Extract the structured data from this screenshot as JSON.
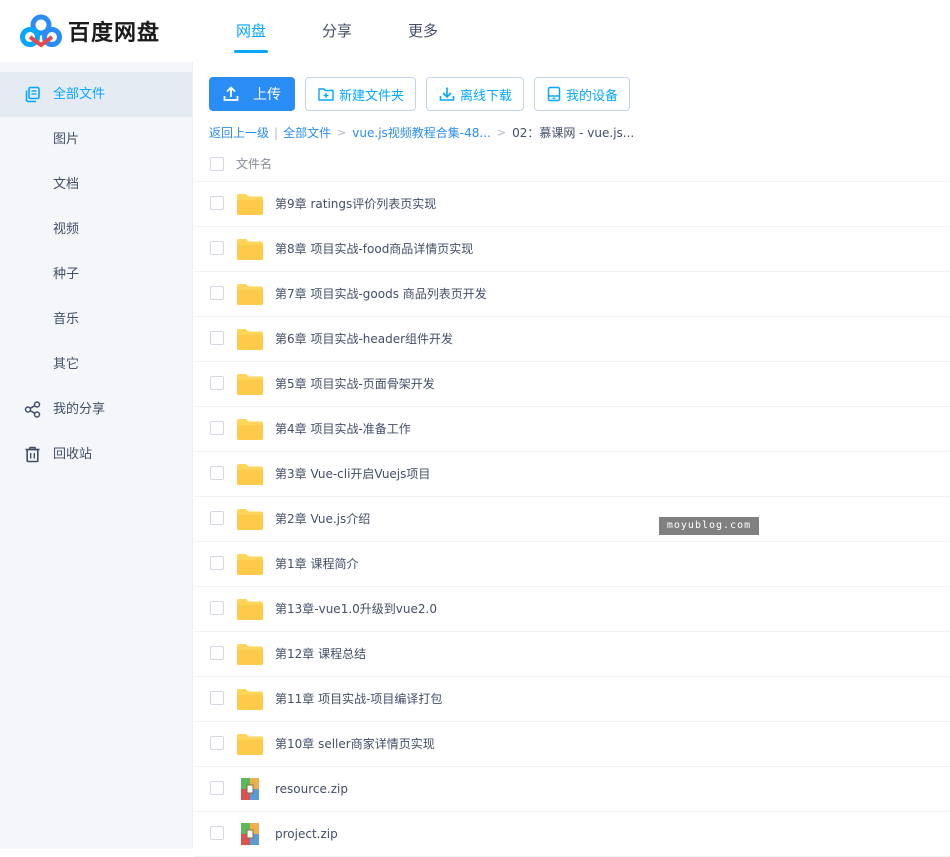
{
  "app": {
    "logo_text": "百度网盘"
  },
  "nav": [
    {
      "label": "网盘",
      "active": true
    },
    {
      "label": "分享",
      "active": false
    },
    {
      "label": "更多",
      "active": false
    }
  ],
  "sidebar": {
    "items": [
      {
        "label": "全部文件",
        "icon": "all-files-icon",
        "active": true
      },
      {
        "label": "图片"
      },
      {
        "label": "文档"
      },
      {
        "label": "视频"
      },
      {
        "label": "种子"
      },
      {
        "label": "音乐"
      },
      {
        "label": "其它"
      },
      {
        "label": "我的分享",
        "icon": "share-icon"
      },
      {
        "label": "回收站",
        "icon": "trash-icon"
      }
    ]
  },
  "toolbar": {
    "upload": "上传",
    "new_folder": "新建文件夹",
    "offline_download": "离线下载",
    "my_devices": "我的设备"
  },
  "breadcrumb": {
    "back": "返回上一级",
    "sep": "|",
    "root": "全部文件",
    "level1": "vue.js视频教程合集-48...",
    "current": "02：慕课网 - vue.js..."
  },
  "list": {
    "column_name": "文件名",
    "rows": [
      {
        "name": "第9章 ratings评价列表页实现",
        "type": "folder"
      },
      {
        "name": "第8章 项目实战-food商品详情页实现",
        "type": "folder"
      },
      {
        "name": "第7章 项目实战-goods 商品列表页开发",
        "type": "folder"
      },
      {
        "name": "第6章 项目实战-header组件开发",
        "type": "folder"
      },
      {
        "name": "第5章 项目实战-页面骨架开发",
        "type": "folder"
      },
      {
        "name": "第4章 项目实战-准备工作",
        "type": "folder"
      },
      {
        "name": "第3章 Vue-cli开启Vuejs项目",
        "type": "folder"
      },
      {
        "name": "第2章 Vue.js介绍",
        "type": "folder"
      },
      {
        "name": "第1章 课程简介",
        "type": "folder"
      },
      {
        "name": "第13章-vue1.0升级到vue2.0",
        "type": "folder"
      },
      {
        "name": "第12章 课程总结",
        "type": "folder"
      },
      {
        "name": "第11章 项目实战-项目编译打包",
        "type": "folder"
      },
      {
        "name": "第10章 seller商家详情页实现",
        "type": "folder"
      },
      {
        "name": "resource.zip",
        "type": "zip"
      },
      {
        "name": "project.zip",
        "type": "zip"
      }
    ]
  },
  "watermark": "moyublog.com",
  "colors": {
    "accent": "#06a7ff",
    "primary_button": "#2a8cf5",
    "folder": "#ffd45b",
    "sidebar_bg": "#f5f6f9"
  }
}
